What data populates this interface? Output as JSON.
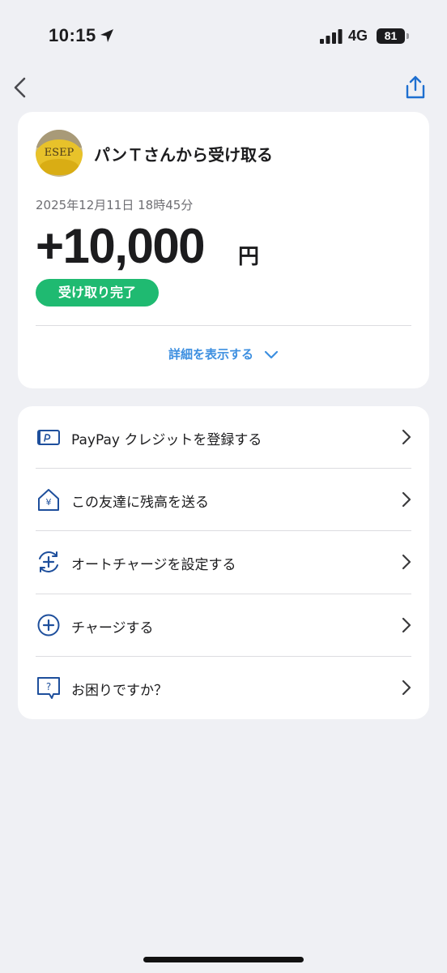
{
  "status_bar": {
    "time": "10:15",
    "network": "4G",
    "battery": "81",
    "icons": [
      "location-arrow-icon",
      "signal-bars-icon",
      "battery-icon"
    ]
  },
  "nav": {
    "back_icon": "chevron-left-icon",
    "share_icon": "share-icon"
  },
  "transaction": {
    "title": "パンＴさんから受け取る",
    "datetime": "2025年12月11日 18時45分",
    "amount": "+10,000",
    "currency": "円",
    "status": "受け取り完了",
    "details_label": "詳細を表示する",
    "avatar_text": "ESEP"
  },
  "menu": [
    {
      "label": "PayPay クレジットを登録する",
      "icon": "credit-card-icon"
    },
    {
      "label": "この友達に残高を送る",
      "icon": "send-money-house-icon"
    },
    {
      "label": "オートチャージを設定する",
      "icon": "auto-charge-icon"
    },
    {
      "label": "チャージする",
      "icon": "plus-circle-icon"
    },
    {
      "label": "お困りですか？",
      "icon": "help-bubble-icon"
    }
  ],
  "colors": {
    "accent_blue": "#3d8fe0",
    "icon_navy": "#1e4f9c",
    "success_green": "#1fba71",
    "background": "#eff0f4"
  }
}
